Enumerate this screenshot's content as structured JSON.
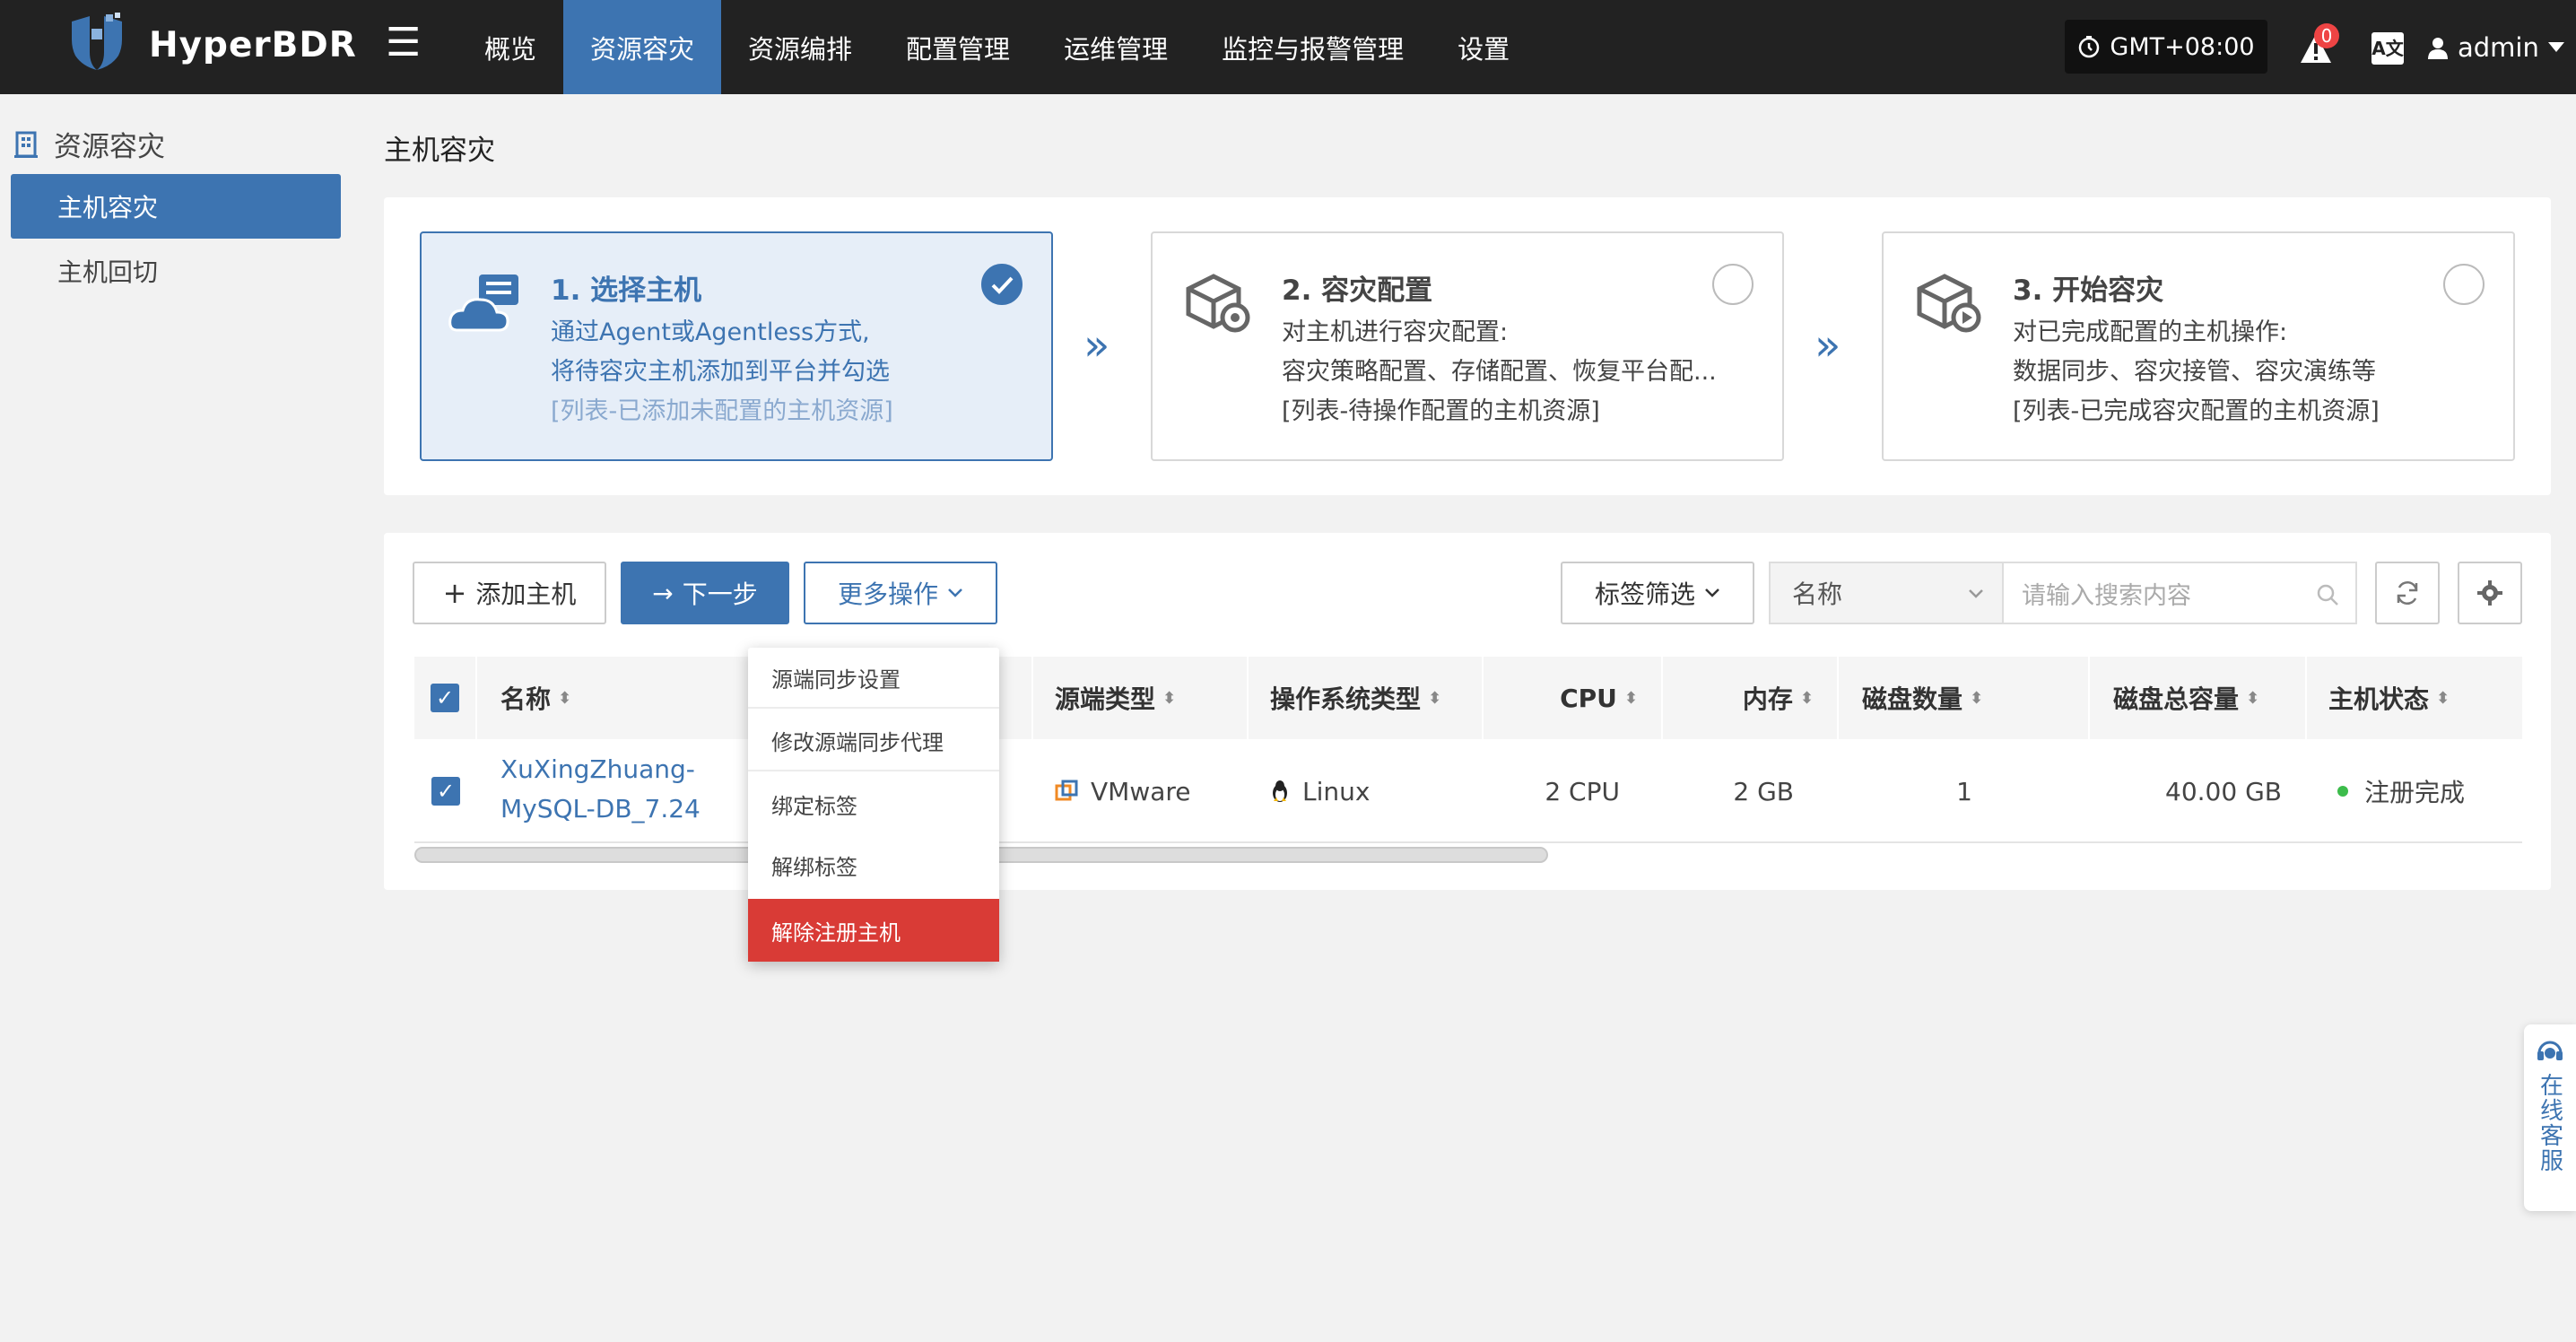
{
  "app": {
    "name": "HyperBDR"
  },
  "nav": [
    {
      "label": "概览"
    },
    {
      "label": "资源容灾",
      "active": true
    },
    {
      "label": "资源编排"
    },
    {
      "label": "配置管理"
    },
    {
      "label": "运维管理"
    },
    {
      "label": "监控与报警管理"
    },
    {
      "label": "设置"
    }
  ],
  "header": {
    "timezone": "GMT+08:00",
    "alert_count": "0",
    "lang_icon": "A文",
    "user": "admin"
  },
  "sidebar": {
    "title": "资源容灾",
    "items": [
      {
        "label": "主机容灾",
        "active": true
      },
      {
        "label": "主机回切"
      }
    ]
  },
  "page": {
    "title": "主机容灾"
  },
  "steps": [
    {
      "title": "1. 选择主机",
      "lines": [
        "通过Agent或Agentless方式,",
        "将待容灾主机添加到平台并勾选"
      ],
      "note": "[列表-已添加未配置的主机资源]",
      "checked": true
    },
    {
      "title": "2. 容灾配置",
      "lines": [
        "对主机进行容灾配置:",
        "容灾策略配置、存储配置、恢复平台配..."
      ],
      "note": "[列表-待操作配置的主机资源]",
      "checked": false
    },
    {
      "title": "3. 开始容灾",
      "lines": [
        "对已完成配置的主机操作:",
        "数据同步、容灾接管、容灾演练等"
      ],
      "note": "[列表-已完成容灾配置的主机资源]",
      "checked": false
    }
  ],
  "toolbar": {
    "add_host": "添加主机",
    "next_step": "下一步",
    "more_actions": "更多操作",
    "tag_filter": "标签筛选",
    "search_field": "名称",
    "search_placeholder": "请输入搜索内容"
  },
  "table": {
    "columns": [
      "名称",
      "源端类型",
      "操作系统类型",
      "CPU",
      "内存",
      "磁盘数量",
      "磁盘总容量",
      "主机状态"
    ],
    "rows": [
      {
        "name_line1": "XuXingZhuang-",
        "name_line2": "MySQL-DB_7.24",
        "source_type": "VMware",
        "os_type": "Linux",
        "cpu": "2 CPU",
        "memory": "2 GB",
        "disk_count": "1",
        "disk_total": "40.00 GB",
        "status": "注册完成",
        "selected": true
      }
    ]
  },
  "dropdown": {
    "items": [
      "源端同步设置",
      "修改源端同步代理",
      "绑定标签",
      "解绑标签",
      "解除注册主机"
    ]
  },
  "support": {
    "label": "在线客服"
  },
  "colors": {
    "primary": "#3d74b1",
    "topbar": "#222222",
    "danger": "#d93b36",
    "status_ok": "#3cbc4b"
  }
}
